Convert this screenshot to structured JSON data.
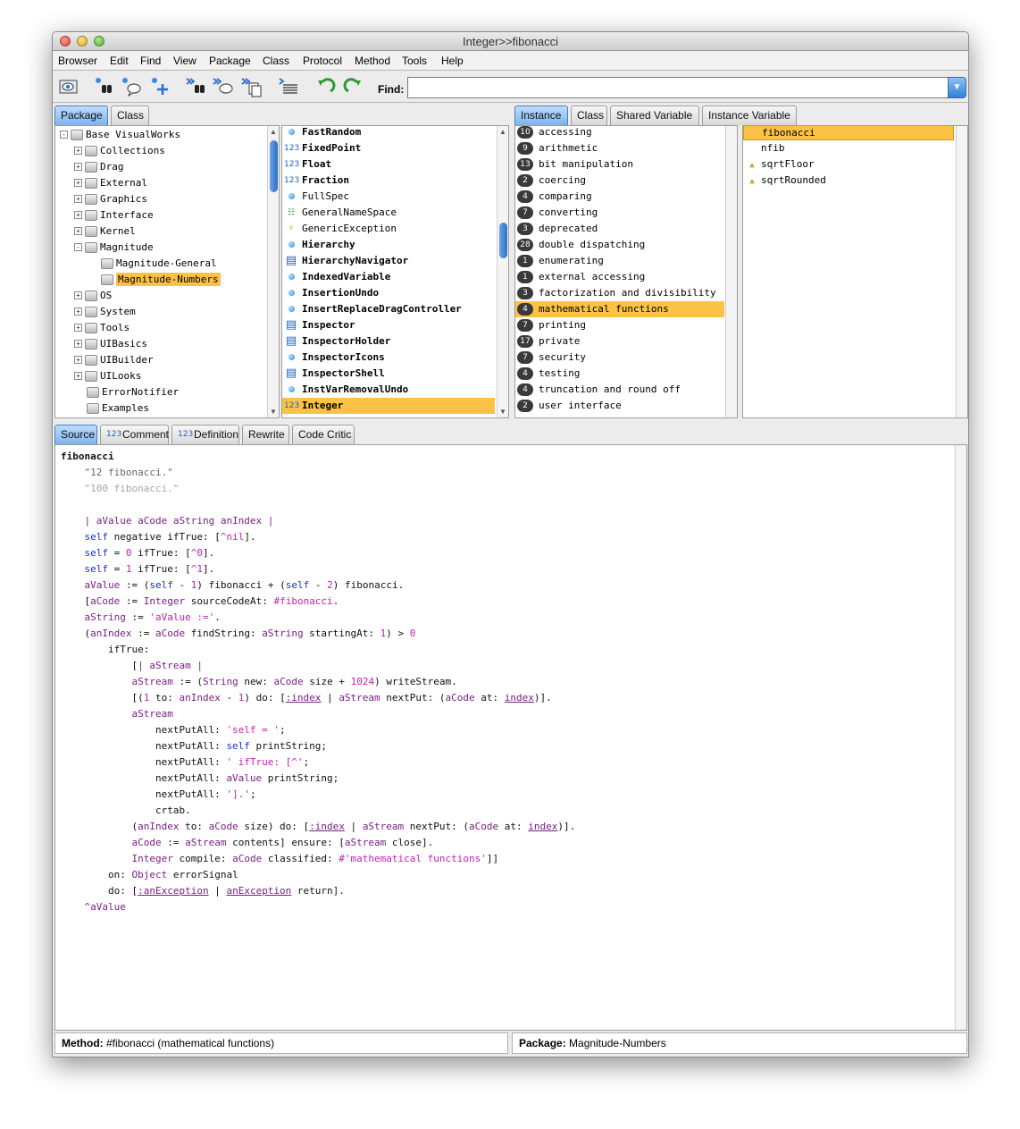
{
  "window": {
    "title": "Integer>>fibonacci"
  },
  "menu": [
    "Browser",
    "Edit",
    "Find",
    "View",
    "Package",
    "Class",
    "Protocol",
    "Method",
    "Tools",
    "Help"
  ],
  "toolbar": {
    "find_label": "Find:",
    "find_value": "",
    "icons": [
      "browser-icon",
      "binoculars-icon",
      "senders-icon",
      "add-icon",
      "find-references-icon",
      "implementors-icon",
      "find-senders-icon",
      "copy-icon",
      "format-icon",
      "undo-icon",
      "redo-icon"
    ]
  },
  "package_tabs": [
    "Package",
    "Class"
  ],
  "packages": [
    {
      "label": "Base VisualWorks",
      "toggle": "-"
    },
    {
      "label": "Collections",
      "toggle": "+"
    },
    {
      "label": "Drag",
      "toggle": "+"
    },
    {
      "label": "External",
      "toggle": "+"
    },
    {
      "label": "Graphics",
      "toggle": "+"
    },
    {
      "label": "Interface",
      "toggle": "+"
    },
    {
      "label": "Kernel",
      "toggle": "+"
    },
    {
      "label": "Magnitude",
      "toggle": "-"
    },
    {
      "label": "Magnitude-General",
      "toggle": ""
    },
    {
      "label": "Magnitude-Numbers",
      "toggle": "",
      "selected": true
    },
    {
      "label": "OS",
      "toggle": "+"
    },
    {
      "label": "System",
      "toggle": "+"
    },
    {
      "label": "Tools",
      "toggle": "+"
    },
    {
      "label": "UIBasics",
      "toggle": "+"
    },
    {
      "label": "UIBuilder",
      "toggle": "+"
    },
    {
      "label": "UILooks",
      "toggle": "+"
    },
    {
      "label": "ErrorNotifier",
      "toggle": ""
    },
    {
      "label": "Examples",
      "toggle": ""
    }
  ],
  "classes": [
    {
      "label": "FastRandom",
      "bold": true,
      "icon": "dot"
    },
    {
      "label": "FixedPoint",
      "bold": true,
      "icon": "123"
    },
    {
      "label": "Float",
      "bold": true,
      "icon": "123"
    },
    {
      "label": "Fraction",
      "bold": true,
      "icon": "123"
    },
    {
      "label": "FullSpec",
      "bold": false,
      "icon": "dot"
    },
    {
      "label": "GeneralNameSpace",
      "bold": false,
      "icon": "tree"
    },
    {
      "label": "GenericException",
      "bold": false,
      "icon": "bolt"
    },
    {
      "label": "Hierarchy",
      "bold": true,
      "icon": "dot"
    },
    {
      "label": "HierarchyNavigator",
      "bold": true,
      "icon": "win"
    },
    {
      "label": "IndexedVariable",
      "bold": true,
      "icon": "dot"
    },
    {
      "label": "InsertionUndo",
      "bold": true,
      "icon": "dot"
    },
    {
      "label": "InsertReplaceDragController",
      "bold": true,
      "icon": "dot"
    },
    {
      "label": "Inspector",
      "bold": true,
      "icon": "win"
    },
    {
      "label": "InspectorHolder",
      "bold": true,
      "icon": "win"
    },
    {
      "label": "InspectorIcons",
      "bold": true,
      "icon": "dot"
    },
    {
      "label": "InspectorShell",
      "bold": true,
      "icon": "win"
    },
    {
      "label": "InstVarRemovalUndo",
      "bold": true,
      "icon": "dot"
    },
    {
      "label": "Integer",
      "bold": true,
      "icon": "123",
      "selected": true
    }
  ],
  "protocol_tabs": [
    "Instance",
    "Class",
    "Shared Variable",
    "Instance Variable"
  ],
  "protocols": [
    {
      "count": "10",
      "label": "accessing"
    },
    {
      "count": "9",
      "label": "arithmetic"
    },
    {
      "count": "13",
      "label": "bit manipulation"
    },
    {
      "count": "2",
      "label": "coercing"
    },
    {
      "count": "4",
      "label": "comparing"
    },
    {
      "count": "7",
      "label": "converting"
    },
    {
      "count": "3",
      "label": "deprecated"
    },
    {
      "count": "28",
      "label": "double dispatching"
    },
    {
      "count": "1",
      "label": "enumerating"
    },
    {
      "count": "1",
      "label": "external accessing"
    },
    {
      "count": "3",
      "label": "factorization and divisibility"
    },
    {
      "count": "4",
      "label": "mathematical functions",
      "selected": true
    },
    {
      "count": "7",
      "label": "printing"
    },
    {
      "count": "17",
      "label": "private"
    },
    {
      "count": "7",
      "label": "security"
    },
    {
      "count": "4",
      "label": "testing"
    },
    {
      "count": "4",
      "label": "truncation and round off"
    },
    {
      "count": "2",
      "label": "user interface"
    }
  ],
  "methods": [
    {
      "label": "fibonacci",
      "selected": true,
      "icon": ""
    },
    {
      "label": "nfib",
      "icon": ""
    },
    {
      "label": "sqrtFloor",
      "icon": "override-icon"
    },
    {
      "label": "sqrtRounded",
      "icon": "override-icon"
    }
  ],
  "editor_tabs": [
    "Source",
    "Comment",
    "Definition",
    "Rewrite",
    "Code Critic"
  ],
  "source": {
    "selector": "fibonacci",
    "comment1": "\"12 fibonacci.\"",
    "comment2": "\"100 fibonacci.\""
  },
  "status": {
    "method_label": "Method:",
    "method_value": "#fibonacci (mathematical functions)",
    "package_label": "Package:",
    "package_value": "Magnitude-Numbers"
  }
}
